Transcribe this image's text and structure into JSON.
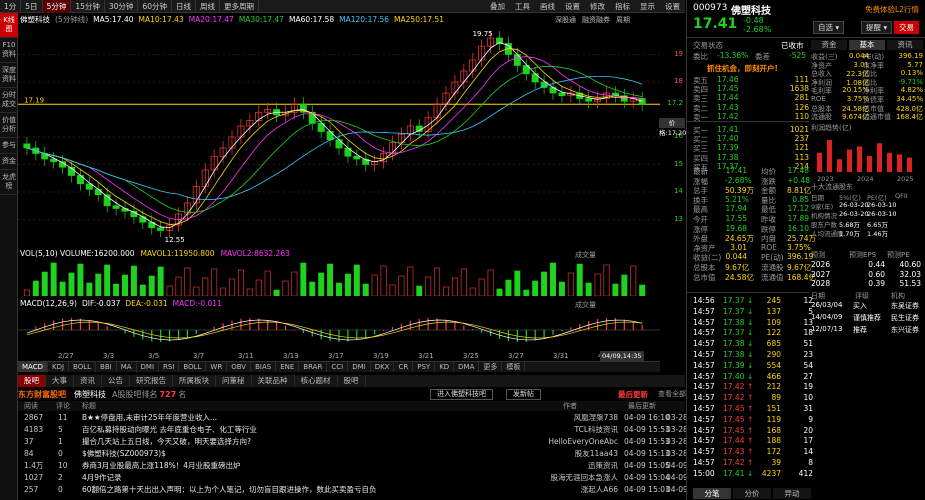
{
  "topbar": {
    "tabs": [
      "1分",
      "5日",
      "5分钟",
      "15分钟",
      "30分钟",
      "60分钟",
      "日线",
      "周线",
      "更多周期"
    ],
    "active": 2,
    "right": [
      "叠加",
      "工具",
      "画线",
      "设置",
      "修改",
      "指标",
      "显示",
      "设置"
    ]
  },
  "leftstrip": [
    "K线图",
    "F10资料",
    "深度资料",
    "分时成交",
    "价值分析",
    "参与",
    "资金",
    "龙虎榜"
  ],
  "ma": {
    "name": "佛塑科技",
    "period": "(5分钟线)",
    "items": [
      {
        "label": "MA5:17.40",
        "color": "#ffffff"
      },
      {
        "label": "MA10:17.43",
        "color": "#ffd700"
      },
      {
        "label": "MA20:17.47",
        "color": "#ff33ff"
      },
      {
        "label": "MA30:17.47",
        "color": "#1fd21f"
      },
      {
        "label": "MA60:17.58",
        "color": "#ffffff"
      },
      {
        "label": "MA120:17.56",
        "color": "#3cc8ff"
      },
      {
        "label": "MA250:17.51",
        "color": "#ffd700"
      }
    ],
    "right": [
      "深股通",
      "融资融券",
      "周期"
    ]
  },
  "chart_data": {
    "type": "candlestick",
    "ylim": [
      12.0,
      20.0
    ],
    "yticks": [
      19.0,
      18.0,
      17.2,
      16.0,
      15.0,
      14.0,
      13.0
    ],
    "current_price": "17.19",
    "price_label": "价格:17.20",
    "high_label": "19.75",
    "low_label": "12.55",
    "closes": [
      15.6,
      15.4,
      15.2,
      15.1,
      14.9,
      14.6,
      14.3,
      14.1,
      13.9,
      13.5,
      13.4,
      13.3,
      13.1,
      12.9,
      12.7,
      12.6,
      12.8,
      13.2,
      13.6,
      14.2,
      14.8,
      15.3,
      15.6,
      16.0,
      16.4,
      16.6,
      16.9,
      17.0,
      16.8,
      16.9,
      17.2,
      16.9,
      16.5,
      16.2,
      15.9,
      15.6,
      15.3,
      15.2,
      15.0,
      15.1,
      15.4,
      15.8,
      16.1,
      16.4,
      16.2,
      16.7,
      17.2,
      17.6,
      18.0,
      18.4,
      18.8,
      19.3,
      19.6,
      19.4,
      19.0,
      18.6,
      18.3,
      18.0,
      17.8,
      17.6,
      17.5,
      17.6,
      17.4,
      17.3,
      17.4,
      17.6,
      17.5,
      17.3,
      17.4,
      17.2
    ]
  },
  "volume": {
    "head": "VOL(5,10)  VOLUME:16200.000",
    "ma1": "MAVOL1:11950.800",
    "ma2": "MAVOL2:8632.263",
    "right": "成交量"
  },
  "macd": {
    "head": "MACD(12,26,9)",
    "dif": "DIF:-0.037",
    "dea": "DEA:-0.031",
    "macd": "MACD:-0.011",
    "right": "成交量"
  },
  "dates": [
    "2/27",
    "3/3",
    "3/5",
    "3/7",
    "3/11",
    "3/13",
    "3/17",
    "3/19",
    "3/21",
    "3/25",
    "3/27",
    "3/31",
    "4/2"
  ],
  "cursor_date": "04/09,14:35",
  "indtabs": [
    "MACD",
    "KDJ",
    "BOLL",
    "BBI",
    "MA",
    "DMI",
    "RSI",
    "BOLL",
    "WR",
    "OBV",
    "BIAS",
    "ENE",
    "BRAR",
    "CCI",
    "DMI",
    "DKX",
    "CR",
    "PSY",
    "KD",
    "DMA",
    "更多",
    "模板"
  ],
  "newstabs": [
    "股吧",
    "大事",
    "资讯",
    "公告",
    "研究报告",
    "所属板块",
    "问董秘",
    "关联品种",
    "核心题材",
    "股吧"
  ],
  "newsbar": {
    "logo": "东方财富股吧",
    "stock": "佛塑科技",
    "rank_label": "A股股吧排名",
    "rank": "727",
    "rank_suffix": "名",
    "btn1": "进入佛塑科技吧",
    "btn2": "发新帖",
    "latest": "最后更新",
    "latest2": "查看全部"
  },
  "newshdr": [
    "阅读",
    "评论",
    "标题",
    "作者",
    "最后更新"
  ],
  "news": [
    {
      "read": "2867",
      "cmt": "11",
      "title": "B★★停盘用,未审计25年年度营业收入...",
      "author": "风凰涅槃738",
      "time": "04-09 16:10",
      "d": "03-28"
    },
    {
      "read": "4183",
      "cmt": "5",
      "title": "百亿私募持股动向曝光 去年底重仓电子、化工等行业",
      "author": "TCL科技资讯",
      "time": "04-09 15:53",
      "d": "03-28"
    },
    {
      "read": "37",
      "cmt": "1",
      "title": "撮合几天站上五日线，今天又破，明天要选择方向?",
      "author": "HelloEveryOneAbc",
      "time": "04-09 15:53",
      "d": "03-28"
    },
    {
      "read": "84",
      "cmt": "0",
      "title": "$佛塑科技(SZ000973)$",
      "author": "股友11aa43",
      "time": "04-09 15:13",
      "d": "03-28"
    },
    {
      "read": "1.4万",
      "cmt": "10",
      "title": "券商3月业股最高上涨118%！4月业股重磅出炉",
      "author": "迅策资讯",
      "time": "04-09 15:05",
      "d": "04-09"
    },
    {
      "read": "1027",
      "cmt": "2",
      "title": "4月9作记录",
      "author": "股海无涯回本急涨人",
      "time": "04-09 15:04",
      "d": "04-09"
    },
    {
      "read": "257",
      "cmt": "0",
      "title": "60翻倍之路第十天出出入声明：以上为个人笔记，切勿盲目跟进操作，数此买卖盈亏自负",
      "author": "涨起人A66",
      "time": "04-09 15:03",
      "d": "04-09"
    }
  ],
  "rp": {
    "code": "000973",
    "name": "佛塑科技",
    "l2": "免费体验L2行情",
    "price": "17.41",
    "chg": "-0.48",
    "pct": "-2.68%",
    "btn_self": "自选",
    "btn_alert": "提醒",
    "btn_trade": "交易",
    "status_label": "交易状态",
    "status": "已收市",
    "ratio_label": "委比",
    "ratio": "-13.36%",
    "diff_label": "委差",
    "diff": "-525",
    "notice": "抓住机会，即刻开户!",
    "sells": [
      {
        "l": "卖五",
        "p": "17.46",
        "v": "111"
      },
      {
        "l": "卖四",
        "p": "17.45",
        "v": "1638"
      },
      {
        "l": "卖三",
        "p": "17.44",
        "v": "281"
      },
      {
        "l": "卖二",
        "p": "17.43",
        "v": "126"
      },
      {
        "l": "卖一",
        "p": "17.42",
        "v": "110"
      }
    ],
    "buys": [
      {
        "l": "买一",
        "p": "17.41",
        "v": "1021"
      },
      {
        "l": "买二",
        "p": "17.40",
        "v": "237"
      },
      {
        "l": "买三",
        "p": "17.39",
        "v": "121"
      },
      {
        "l": "买四",
        "p": "17.38",
        "v": "113"
      },
      {
        "l": "买五",
        "p": "17.37",
        "v": "214"
      }
    ],
    "stats": [
      [
        "最新",
        "17.41",
        "均价",
        "17.48"
      ],
      [
        "涨幅",
        "-2.68%",
        "涨跌",
        "+0.48"
      ],
      [
        "总手",
        "50.39万",
        "金额",
        "8.81亿"
      ],
      [
        "换手",
        "5.21%",
        "量比",
        "0.85"
      ],
      [
        "最高",
        "17.94",
        "最低",
        "17.12"
      ],
      [
        "今开",
        "17.55",
        "昨收",
        "17.89"
      ],
      [
        "涨停",
        "19.68",
        "跌停",
        "16.10"
      ],
      [
        "外盘",
        "24.65万",
        "内盘",
        "25.74万"
      ],
      [
        "净资产",
        "3.01",
        "ROE",
        "3.75%"
      ],
      [
        "收益(二)",
        "0.044",
        "PE(动)",
        "396.19"
      ],
      [
        "总股本",
        "9.67亿",
        "流通股",
        "9.67亿"
      ],
      [
        "总市值",
        "24.58亿",
        "流通值",
        "168.4亿"
      ]
    ],
    "rtabs": [
      "资金",
      "基本",
      "资讯"
    ],
    "fund": [
      [
        "收益(三)",
        "0.044",
        "PE(动)",
        "396.19"
      ],
      [
        "净资产",
        "3.01",
        "市净率",
        "5.77"
      ],
      [
        "总收入",
        "22.3亿",
        "同比",
        "0.13%"
      ],
      [
        "净利润",
        "1.08亿",
        "同比",
        "-9.71%"
      ],
      [
        "毛利率",
        "20.15%",
        "净利率",
        "4.82%"
      ],
      [
        "ROE",
        "3.75%",
        "负债率",
        "34.45%"
      ],
      [
        "总股本",
        "24.58亿",
        "总市值",
        "428.0亿"
      ],
      [
        "流通股",
        "9.674亿",
        "流通市值",
        "168.4亿"
      ]
    ],
    "profit_title": "利润趋势(亿)",
    "profit_years": [
      "2023",
      "2024",
      "2025"
    ],
    "holders_title": "十大流通股东",
    "holders": [
      [
        "日期",
        "5%(亿)",
        "PE(亿)",
        "QFII"
      ],
      [
        "9家(年)",
        "26-03-20",
        "26-03-10",
        ""
      ],
      [
        "机构情况",
        "26-03-20",
        "26-03-10",
        ""
      ],
      [
        "股东户数",
        "5.68万",
        "6.65万",
        ""
      ],
      [
        "人均流通股",
        "1.70万",
        "1.46万",
        ""
      ]
    ],
    "fc_tabs": [
      "预测",
      "预测EPS",
      "预测PE"
    ],
    "forecast": [
      [
        "2026",
        "0.44",
        "40.60"
      ],
      [
        "2027",
        "0.60",
        "32.03"
      ],
      [
        "2028",
        "0.39",
        "51.53"
      ]
    ],
    "rating_hdr": [
      "日期",
      "评级",
      "机构"
    ],
    "ratings": [
      [
        "26/03/04",
        "买入",
        "东吴证券"
      ],
      [
        "14/04/09",
        "谨慎推荐",
        "民生证券"
      ],
      [
        "12/07/13",
        "推荐",
        "东兴证券"
      ]
    ],
    "ticks": [
      [
        "14:56",
        "17.37",
        "245",
        "12"
      ],
      [
        "14:57",
        "17.37",
        "137",
        "5"
      ],
      [
        "14:57",
        "17.38",
        "109",
        "13"
      ],
      [
        "14:57",
        "17.37",
        "122",
        "18"
      ],
      [
        "14:57",
        "17.38",
        "685",
        "51"
      ],
      [
        "14:57",
        "17.38",
        "290",
        "23"
      ],
      [
        "14:57",
        "17.39",
        "554",
        "54"
      ],
      [
        "14:57",
        "17.40",
        "466",
        "27"
      ],
      [
        "14:57",
        "17.42",
        "212",
        "19"
      ],
      [
        "14:57",
        "17.42",
        "89",
        "10"
      ],
      [
        "14:57",
        "17.45",
        "151",
        "31"
      ],
      [
        "14:57",
        "17.45",
        "119",
        "9"
      ],
      [
        "14:57",
        "17.45",
        "168",
        "20"
      ],
      [
        "14:57",
        "17.44",
        "188",
        "17"
      ],
      [
        "14:57",
        "17.43",
        "172",
        "14"
      ],
      [
        "14:57",
        "17.42",
        "39",
        "8"
      ],
      [
        "15:00",
        "17.41",
        "4237",
        "412"
      ]
    ],
    "btabs": [
      "分笔",
      "分价",
      "异动"
    ]
  }
}
